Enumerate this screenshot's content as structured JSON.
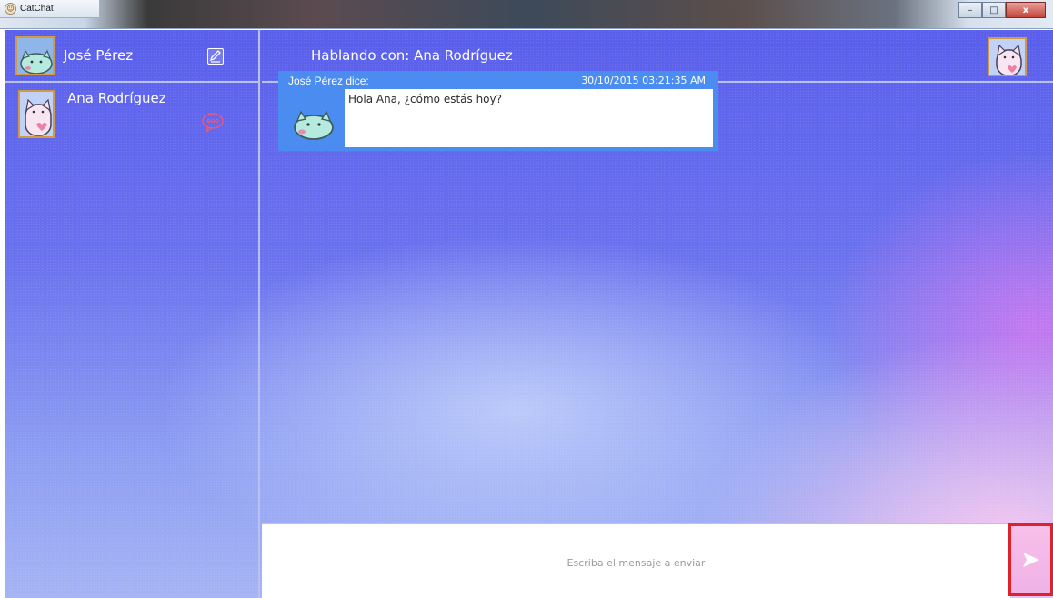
{
  "window": {
    "title": "CatChat",
    "controls": {
      "minimize": "–",
      "maximize": "□",
      "close": "x"
    }
  },
  "sidebar": {
    "current_user": "José Pérez",
    "contacts": [
      {
        "name": "Ana Rodríguez",
        "unread_icon": "chat-bubble-icon"
      }
    ]
  },
  "chat": {
    "header": "Hablando con: Ana Rodríguez",
    "messages": [
      {
        "author": "José Pérez dice:",
        "timestamp": "30/10/2015 03:21:35 AM",
        "text": "Hola Ana, ¿cómo estás hoy?"
      }
    ],
    "input": {
      "placeholder": "Escriba el mensaje a enviar",
      "value": ""
    },
    "send_icon": "send-arrow-icon"
  },
  "colors": {
    "bg_top": "#5a5fec",
    "bg_pink": "#f0b2e6",
    "message_border": "#4a8cf0",
    "avatar_border": "#d19a45",
    "send_highlight": "#e0202a"
  }
}
